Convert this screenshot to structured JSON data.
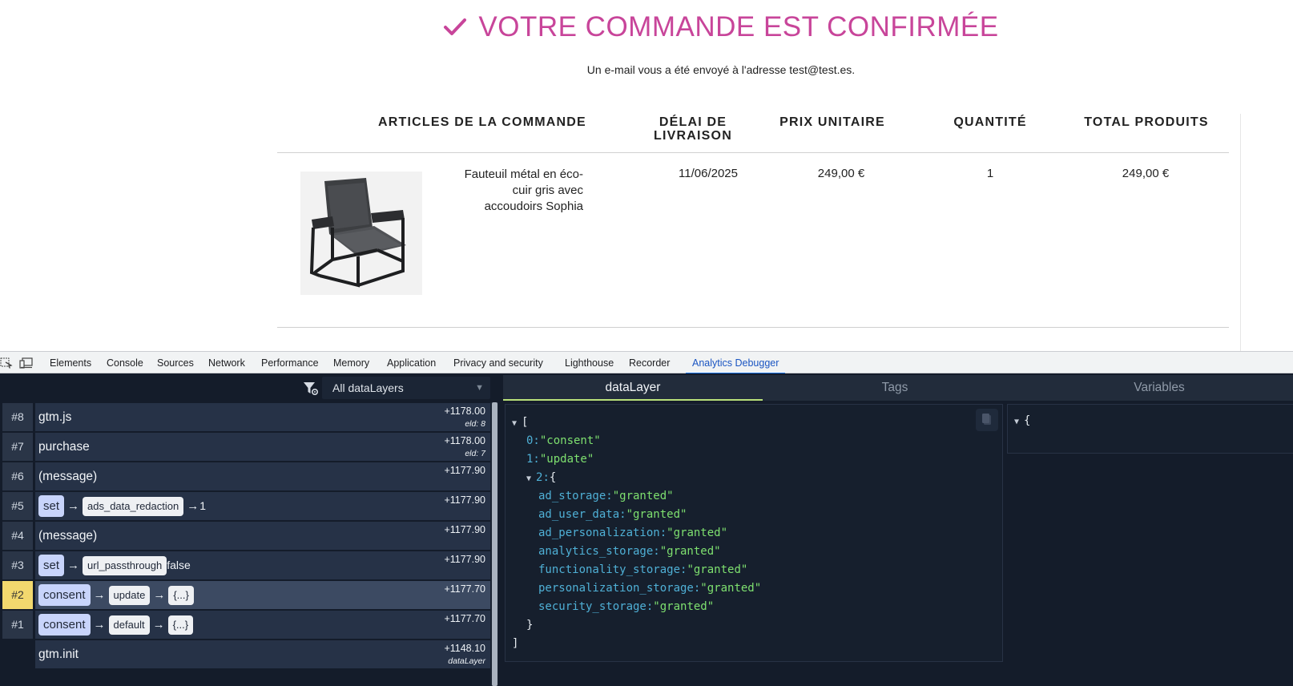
{
  "page": {
    "title": "VOTRE COMMANDE EST CONFIRMÉE",
    "email_note": "Un e-mail vous a été envoyé à l'adresse test@test.es.",
    "table": {
      "headers": {
        "articles": "ARTICLES DE LA COMMANDE",
        "delai_line1": "DÉLAI DE",
        "delai_line2": "LIVRAISON",
        "prix": "PRIX UNITAIRE",
        "quantite": "QUANTITÉ",
        "total": "TOTAL PRODUITS"
      },
      "item": {
        "name_line1": "Fauteuil métal en éco-",
        "name_line2": "cuir gris avec",
        "name_line3": "accoudoirs Sophia",
        "delai": "11/06/2025",
        "prix": "249,00 €",
        "quantite": "1",
        "total": "249,00 €"
      }
    },
    "colors": {
      "accent": "#c8459a"
    }
  },
  "devtools": {
    "tabs": [
      "Elements",
      "Console",
      "Sources",
      "Network",
      "Performance",
      "Memory",
      "Application",
      "Privacy and security",
      "Lighthouse",
      "Recorder",
      "Analytics Debugger"
    ],
    "active_tab": "Analytics Debugger"
  },
  "debugger": {
    "filter_select": "All dataLayers",
    "panel_tabs": [
      "dataLayer",
      "Tags",
      "Variables"
    ],
    "active_panel_tab": "dataLayer",
    "events": [
      {
        "num": "#8",
        "label": "gtm.js",
        "time": "+1178.00",
        "sub": "eld: 8"
      },
      {
        "num": "#7",
        "label": "purchase",
        "time": "+1178.00",
        "sub": "eld: 7"
      },
      {
        "num": "#6",
        "label": "(message)",
        "time": "+1177.90"
      },
      {
        "num": "#5",
        "chip": "set",
        "key": "ads_data_redaction",
        "value": "1",
        "time": "+1177.90"
      },
      {
        "num": "#4",
        "label": "(message)",
        "time": "+1177.90"
      },
      {
        "num": "#3",
        "chip": "set",
        "key": "url_passthrough",
        "value": "false",
        "time": "+1177.90"
      },
      {
        "num": "#2",
        "chip": "consent",
        "key": "update",
        "value": "{...}",
        "time": "+1177.70",
        "selected": true
      },
      {
        "num": "#1",
        "chip": "consent",
        "key": "default",
        "value": "{...}",
        "time": "+1177.70"
      },
      {
        "label": "gtm.init",
        "time": "+1148.10",
        "sub": "dataLayer"
      }
    ],
    "json": {
      "open": "[",
      "i0_key": "0:",
      "i0_val": "\"consent\"",
      "i1_key": "1:",
      "i1_val": "\"update\"",
      "i2_key": "2:",
      "obj_open": "{",
      "entries": [
        {
          "k": "ad_storage:",
          "v": "\"granted\""
        },
        {
          "k": "ad_user_data:",
          "v": "\"granted\""
        },
        {
          "k": "ad_personalization:",
          "v": "\"granted\""
        },
        {
          "k": "analytics_storage:",
          "v": "\"granted\""
        },
        {
          "k": "functionality_storage:",
          "v": "\"granted\""
        },
        {
          "k": "personalization_storage:",
          "v": "\"granted\""
        },
        {
          "k": "security_storage:",
          "v": "\"granted\""
        }
      ],
      "obj_close": "}",
      "close": "]"
    },
    "vars_open": "{"
  }
}
